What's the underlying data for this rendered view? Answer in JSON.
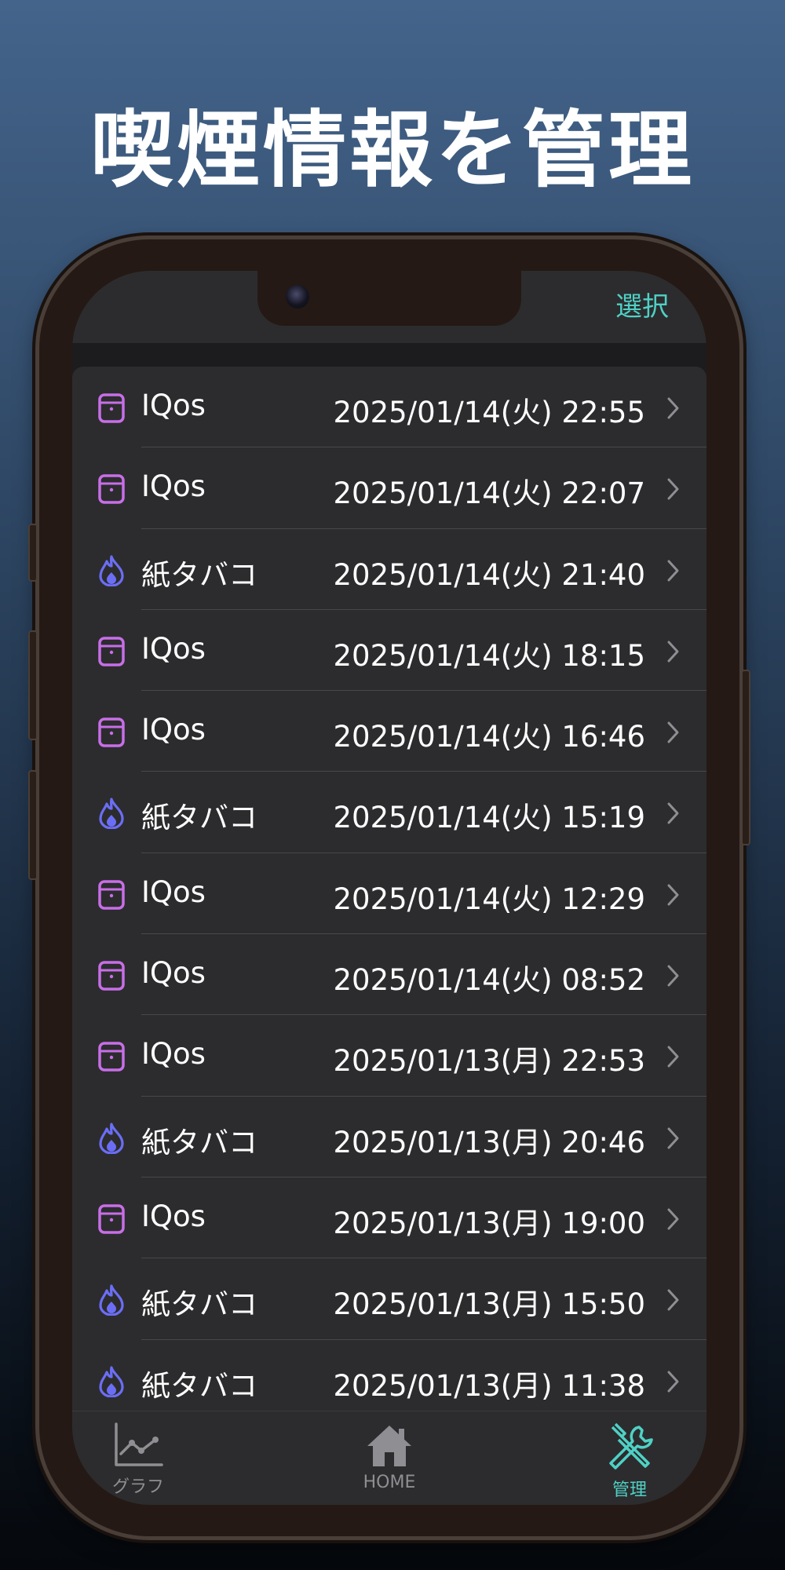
{
  "headline": "喫煙情報を管理",
  "navbar": {
    "select_label": "選択"
  },
  "records": [
    {
      "type": "iqos",
      "label": "IQos",
      "datetime": "2025/01/14(火) 22:55"
    },
    {
      "type": "iqos",
      "label": "IQos",
      "datetime": "2025/01/14(火) 22:07"
    },
    {
      "type": "paper",
      "label": "紙タバコ",
      "datetime": "2025/01/14(火) 21:40"
    },
    {
      "type": "iqos",
      "label": "IQos",
      "datetime": "2025/01/14(火) 18:15"
    },
    {
      "type": "iqos",
      "label": "IQos",
      "datetime": "2025/01/14(火) 16:46"
    },
    {
      "type": "paper",
      "label": "紙タバコ",
      "datetime": "2025/01/14(火) 15:19"
    },
    {
      "type": "iqos",
      "label": "IQos",
      "datetime": "2025/01/14(火) 12:29"
    },
    {
      "type": "iqos",
      "label": "IQos",
      "datetime": "2025/01/14(火) 08:52"
    },
    {
      "type": "iqos",
      "label": "IQos",
      "datetime": "2025/01/13(月) 22:53"
    },
    {
      "type": "paper",
      "label": "紙タバコ",
      "datetime": "2025/01/13(月) 20:46"
    },
    {
      "type": "iqos",
      "label": "IQos",
      "datetime": "2025/01/13(月) 19:00"
    },
    {
      "type": "paper",
      "label": "紙タバコ",
      "datetime": "2025/01/13(月) 15:50"
    },
    {
      "type": "paper",
      "label": "紙タバコ",
      "datetime": "2025/01/13(月) 11:38"
    }
  ],
  "icons": {
    "iqos": "iqos-device-icon",
    "paper": "flame-icon"
  },
  "tabbar": {
    "tabs": [
      {
        "label": "グラフ",
        "icon": "graph-icon",
        "active": false
      },
      {
        "label": "HOME",
        "icon": "home-icon",
        "active": false
      },
      {
        "label": "管理",
        "icon": "tools-icon",
        "active": true
      }
    ]
  },
  "colors": {
    "accent": "#4fd1c5",
    "iqos_icon": "#c86ee8",
    "flame_icon": "#6b6ef5",
    "inactive_tab": "#8e8e93",
    "list_bg": "#2c2c2e",
    "separator": "#48484a"
  }
}
